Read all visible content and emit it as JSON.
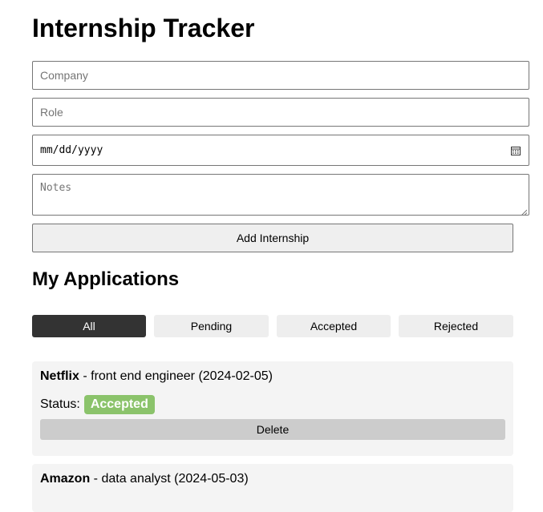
{
  "header": {
    "title": "Internship Tracker"
  },
  "form": {
    "company_placeholder": "Company",
    "role_placeholder": "Role",
    "date_placeholder": "mm/dd/yyyy",
    "notes_placeholder": "Notes",
    "submit_label": "Add Internship"
  },
  "applications": {
    "heading": "My Applications",
    "filters": [
      "All",
      "Pending",
      "Accepted",
      "Rejected"
    ],
    "active_filter": "All",
    "items": [
      {
        "company": "Netflix",
        "detail": " - front end engineer (2024-02-05)",
        "status_label": "Status:",
        "status": "Accepted",
        "status_color": "#8bc36b",
        "delete_label": "Delete"
      },
      {
        "company": "Amazon",
        "detail": " - data analyst (2024-05-03)"
      }
    ]
  },
  "icons": {
    "date_picker": "calendar-icon"
  }
}
